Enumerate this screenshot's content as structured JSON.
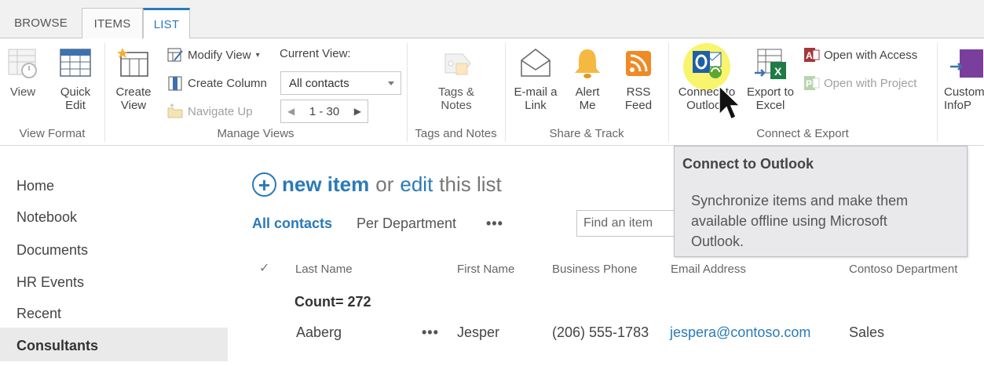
{
  "tabs": [
    {
      "label": "BROWSE"
    },
    {
      "label": "ITEMS"
    },
    {
      "label": "LIST"
    }
  ],
  "ribbon": {
    "view_format": {
      "group_label": "View Format",
      "view": "View",
      "quick_edit": "Quick\nEdit"
    },
    "manage_views": {
      "group_label": "Manage Views",
      "create_view": "Create\nView",
      "modify_view": "Modify View",
      "create_column": "Create Column",
      "navigate_up": "Navigate Up",
      "current_view_label": "Current View:",
      "current_view_value": "All contacts",
      "pager": "1 - 30"
    },
    "tags_notes": {
      "group_label": "Tags and Notes",
      "tags_notes": "Tags &\nNotes"
    },
    "share_track": {
      "group_label": "Share & Track",
      "email_link": "E-mail a\nLink",
      "alert_me": "Alert\nMe",
      "rss_feed": "RSS\nFeed"
    },
    "connect_export": {
      "group_label": "Connect & Export",
      "connect_outlook": "Connect to\nOutlook",
      "export_excel": "Export to\nExcel",
      "open_access": "Open with Access",
      "open_project": "Open with Project"
    },
    "custom": {
      "customize_infopath": "Custom\nInfoP"
    }
  },
  "nav": {
    "items": [
      {
        "label": "Home"
      },
      {
        "label": "Notebook"
      },
      {
        "label": "Documents"
      },
      {
        "label": "HR Events"
      },
      {
        "label": "Recent"
      },
      {
        "label": "Consultants"
      }
    ]
  },
  "main": {
    "new_item": "new item",
    "or": "or",
    "edit": "edit",
    "this_list": "this list",
    "views": {
      "all_contacts": "All contacts",
      "per_department": "Per Department",
      "more": "•••"
    },
    "search_placeholder": "Find an item",
    "columns": [
      "Last Name",
      "First Name",
      "Business Phone",
      "Email Address",
      "Contoso Department"
    ],
    "count_label": "Count= 272",
    "rows": [
      {
        "last_name": "Aaberg",
        "menu": "•••",
        "first_name": "Jesper",
        "phone": "(206) 555-1783",
        "email": "jespera@contoso.com",
        "department": "Sales"
      }
    ]
  },
  "tooltip": {
    "title": "Connect to Outlook",
    "description": "Synchronize items and make them available offline using Microsoft Outlook."
  },
  "colors": {
    "accent": "#2a7ab8",
    "tooltip_bg": "#e9e9ec"
  }
}
